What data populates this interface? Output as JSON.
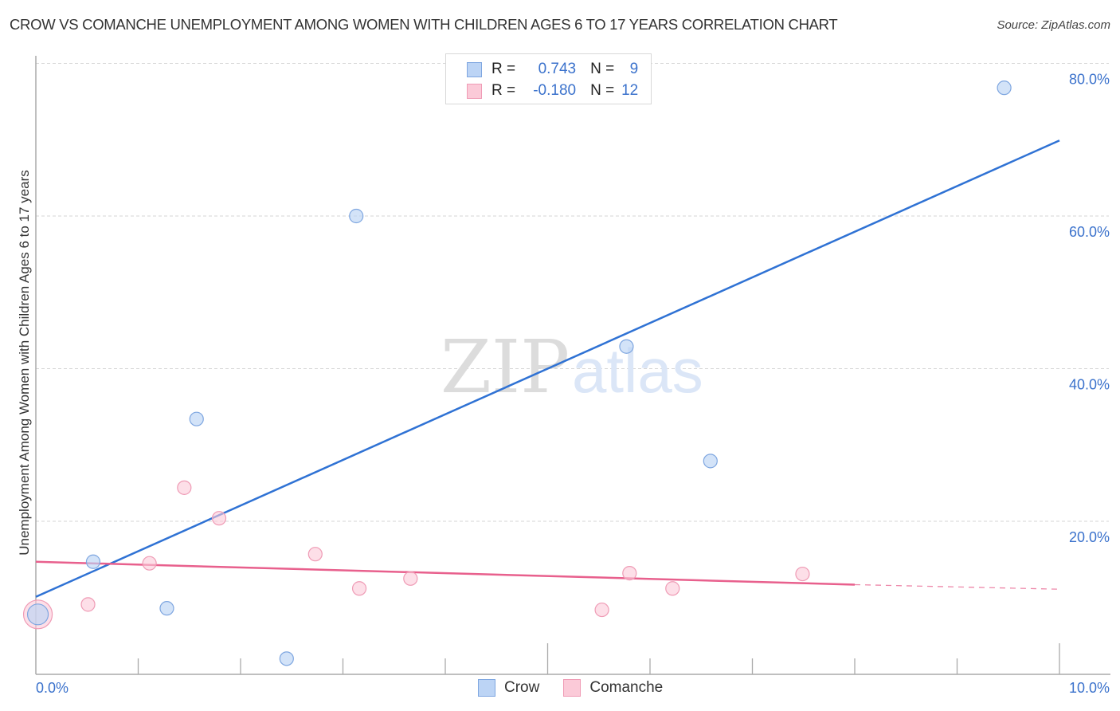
{
  "header": {
    "title": "CROW VS COMANCHE UNEMPLOYMENT AMONG WOMEN WITH CHILDREN AGES 6 TO 17 YEARS CORRELATION CHART",
    "source": "Source: ZipAtlas.com"
  },
  "watermark": {
    "part1": "ZIP",
    "part2": "atlas"
  },
  "legend": {
    "rows": [
      {
        "r_label": "R =",
        "r_value": "0.743",
        "n_label": "N =",
        "n_value": "9"
      },
      {
        "r_label": "R =",
        "r_value": "-0.180",
        "n_label": "N =",
        "n_value": "12"
      }
    ]
  },
  "bottom_legend": {
    "items": [
      "Crow",
      "Comanche"
    ]
  },
  "colors": {
    "crow_fill": "#bcd4f5",
    "crow_stroke": "#7ea6e0",
    "crow_line": "#2f72d4",
    "comanche_fill": "#fbcad8",
    "comanche_stroke": "#ef9bb5",
    "comanche_line": "#e8608d",
    "tick_label": "#3b72cc"
  },
  "chart_data": {
    "type": "scatter",
    "title": "CROW VS COMANCHE UNEMPLOYMENT AMONG WOMEN WITH CHILDREN AGES 6 TO 17 YEARS CORRELATION CHART",
    "xlabel": "",
    "ylabel": "Unemployment Among Women with Children Ages 6 to 17 years",
    "xlim": [
      0,
      10
    ],
    "ylim": [
      0,
      82
    ],
    "x_tick_labels": [
      {
        "value": 0,
        "label": "0.0%"
      },
      {
        "value": 10,
        "label": "10.0%"
      }
    ],
    "x_minor_ticks": [
      1,
      2,
      3,
      4,
      5,
      6,
      7,
      8,
      9
    ],
    "y_tick_labels": [
      {
        "value": 20,
        "label": "20.0%"
      },
      {
        "value": 40,
        "label": "40.0%"
      },
      {
        "value": 60,
        "label": "60.0%"
      },
      {
        "value": 80,
        "label": "80.0%"
      }
    ],
    "grid": "horizontal-dashed",
    "legend_position": "top-center",
    "series": [
      {
        "name": "Crow",
        "R": 0.743,
        "N": 9,
        "points": [
          {
            "x": 0.02,
            "y": 7.8,
            "large": true
          },
          {
            "x": 0.56,
            "y": 14.7
          },
          {
            "x": 1.28,
            "y": 8.6
          },
          {
            "x": 1.57,
            "y": 33.4
          },
          {
            "x": 2.45,
            "y": 2.0
          },
          {
            "x": 3.13,
            "y": 60.0
          },
          {
            "x": 5.77,
            "y": 42.9
          },
          {
            "x": 6.59,
            "y": 27.9
          },
          {
            "x": 9.46,
            "y": 76.8
          }
        ],
        "trend": {
          "x0": 0,
          "y0": 10.1,
          "x1": 10,
          "y1": 69.9
        }
      },
      {
        "name": "Comanche",
        "R": -0.18,
        "N": 12,
        "points": [
          {
            "x": 0.02,
            "y": 7.8,
            "large": true
          },
          {
            "x": 0.51,
            "y": 9.1
          },
          {
            "x": 1.11,
            "y": 14.5
          },
          {
            "x": 1.45,
            "y": 24.4
          },
          {
            "x": 1.79,
            "y": 20.4
          },
          {
            "x": 2.73,
            "y": 15.7
          },
          {
            "x": 3.16,
            "y": 11.2
          },
          {
            "x": 3.66,
            "y": 12.5
          },
          {
            "x": 5.53,
            "y": 8.4
          },
          {
            "x": 5.8,
            "y": 13.2
          },
          {
            "x": 6.22,
            "y": 11.2
          },
          {
            "x": 7.49,
            "y": 13.1
          }
        ],
        "trend": {
          "x0": 0,
          "y0": 14.7,
          "x1": 8.0,
          "y1": 11.7,
          "x_dash_end": 10,
          "y_dash_end": 11.1
        }
      }
    ]
  }
}
